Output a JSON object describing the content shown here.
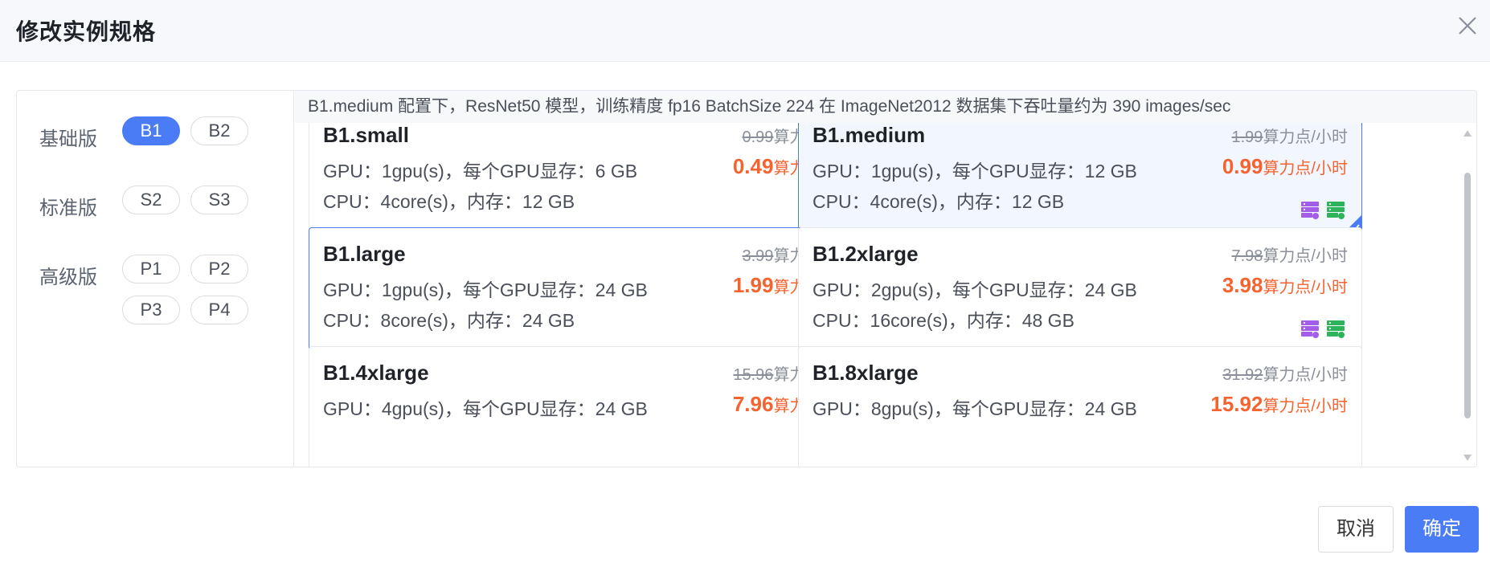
{
  "dialog": {
    "title": "修改实例规格"
  },
  "groups": [
    {
      "label": "基础版",
      "options": [
        "B1",
        "B2"
      ]
    },
    {
      "label": "标准版",
      "options": [
        "S2",
        "S3"
      ]
    },
    {
      "label": "高级版",
      "options": [
        "P1",
        "P2",
        "P3",
        "P4"
      ]
    }
  ],
  "selected_option": "B1",
  "note": "B1.medium 配置下，ResNet50 模型，训练精度 fp16 BatchSize 224 在 ImageNet2012 数据集下吞吐量约为 390 images/sec",
  "cards": [
    {
      "name": "B1.small",
      "gpu": "GPU：1gpu(s)，每个GPU显存：6 GB",
      "cpu": "CPU：4core(s)，内存：12 GB",
      "orig_price": "0.99",
      "price": "0.49",
      "unit": "算力点/小时"
    },
    {
      "name": "B1.medium",
      "gpu": "GPU：1gpu(s)，每个GPU显存：12 GB",
      "cpu": "CPU：4core(s)，内存：12 GB",
      "orig_price": "1.99",
      "price": "0.99",
      "unit": "算力点/小时"
    },
    {
      "name": "B1.large",
      "gpu": "GPU：1gpu(s)，每个GPU显存：24 GB",
      "cpu": "CPU：8core(s)，内存：24 GB",
      "orig_price": "3.99",
      "price": "1.99",
      "unit": "算力点/小时"
    },
    {
      "name": "B1.2xlarge",
      "gpu": "GPU：2gpu(s)，每个GPU显存：24 GB",
      "cpu": "CPU：16core(s)，内存：48 GB",
      "orig_price": "7.98",
      "price": "3.98",
      "unit": "算力点/小时"
    },
    {
      "name": "B1.4xlarge",
      "gpu": "GPU：4gpu(s)，每个GPU显存：24 GB",
      "cpu": "",
      "orig_price": "15.96",
      "price": "7.96",
      "unit": "算力点/小时"
    },
    {
      "name": "B1.8xlarge",
      "gpu": "GPU：8gpu(s)，每个GPU显存：24 GB",
      "cpu": "",
      "orig_price": "31.92",
      "price": "15.92",
      "unit": "算力点/小时"
    }
  ],
  "selected_card": "B1.medium",
  "hover_card": "B1.large",
  "icons": {
    "card_icons": [
      "server-purple-icon",
      "cloud-server-green-icon"
    ]
  },
  "colors": {
    "accent": "#4a7cf6",
    "price": "#f5632f",
    "icon_purple": "#a35de8",
    "icon_green": "#2fb35a"
  },
  "footer": {
    "cancel_label": "取消",
    "ok_label": "确定"
  }
}
